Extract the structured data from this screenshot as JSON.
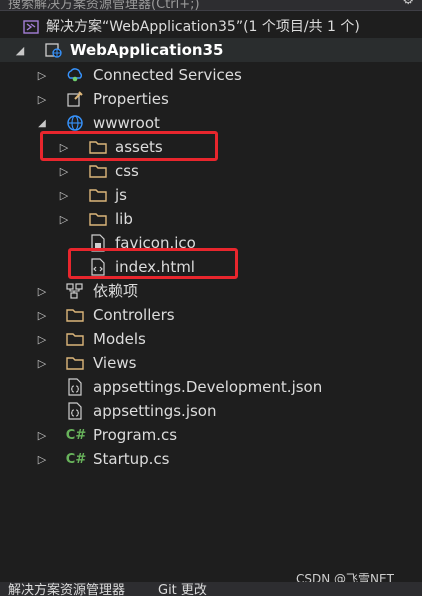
{
  "search": {
    "placeholder": "搜索解决方案资源管理器(Ctrl+;)",
    "options_glyph": "⚙"
  },
  "solution": {
    "label": "解决方案“WebApplication35”(1 个项目/共 1 个)"
  },
  "project": {
    "label": "WebApplication35"
  },
  "items": [
    {
      "label": "Connected Services",
      "icon": "connected-services-icon"
    },
    {
      "label": "Properties",
      "icon": "wrench-icon"
    },
    {
      "label": "wwwroot",
      "icon": "globe-icon"
    },
    {
      "label": "assets",
      "icon": "folder-icon"
    },
    {
      "label": "css",
      "icon": "folder-icon"
    },
    {
      "label": "js",
      "icon": "folder-icon"
    },
    {
      "label": "lib",
      "icon": "folder-icon"
    },
    {
      "label": "favicon.ico",
      "icon": "file-icon"
    },
    {
      "label": "index.html",
      "icon": "html-file-icon"
    },
    {
      "label": "依赖项",
      "icon": "dependencies-icon"
    },
    {
      "label": "Controllers",
      "icon": "folder-icon"
    },
    {
      "label": "Models",
      "icon": "folder-icon"
    },
    {
      "label": "Views",
      "icon": "folder-icon"
    },
    {
      "label": "appsettings.Development.json",
      "icon": "json-file-icon"
    },
    {
      "label": "appsettings.json",
      "icon": "json-file-icon"
    },
    {
      "label": "Program.cs",
      "icon": "csharp-file-icon"
    },
    {
      "label": "Startup.cs",
      "icon": "csharp-file-icon"
    }
  ],
  "bottom_tabs": [
    {
      "label": "解决方案资源管理器"
    },
    {
      "label": "Git 更改"
    }
  ],
  "watermark": "CSDN @飞雪NET",
  "colors": {
    "highlight": "#e8262d",
    "folder": "#dcb67a",
    "csharp": "#68b35b",
    "globe": "#3794ff"
  }
}
